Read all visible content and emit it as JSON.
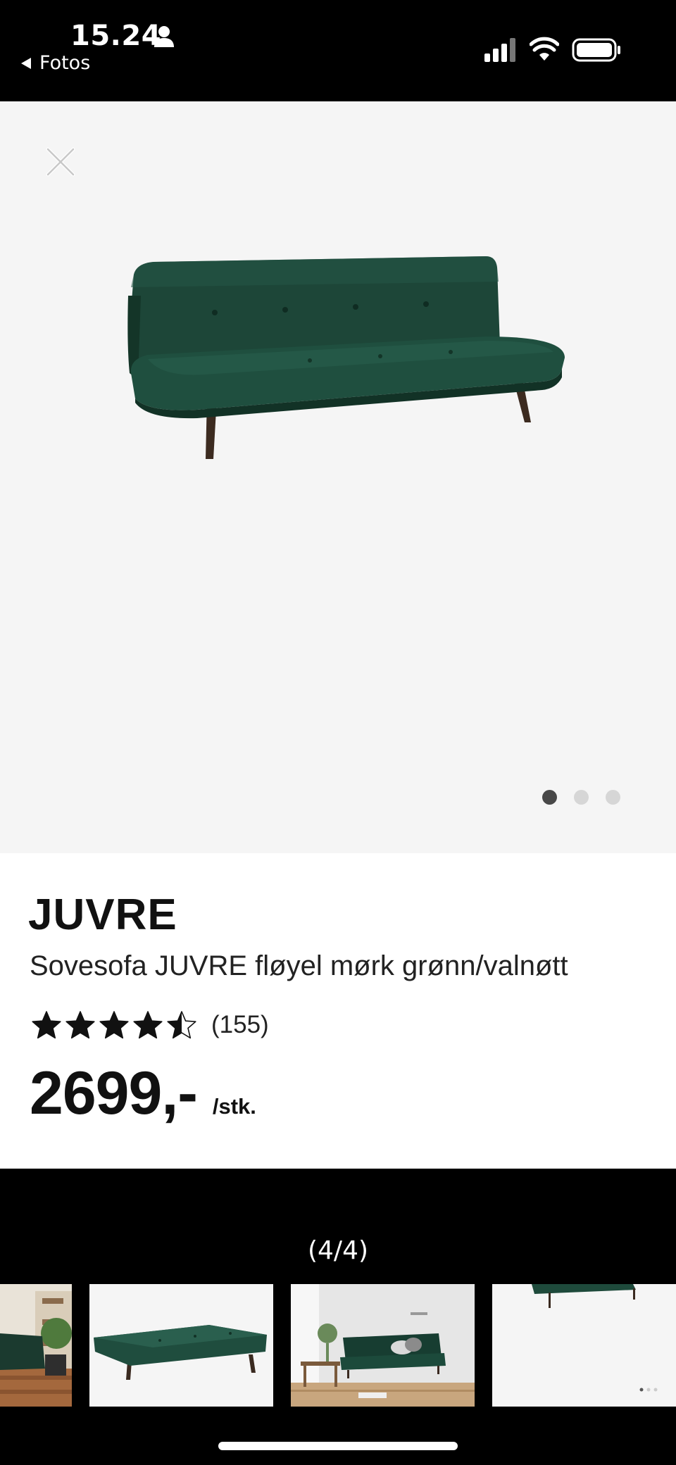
{
  "status_bar": {
    "time": "15.24",
    "back_label": "Fotos"
  },
  "product": {
    "brand": "JUVRE",
    "description": "Sovesofa JUVRE fløyel mørk grønn/valnøtt",
    "rating": 4.5,
    "review_count": "(155)",
    "price": "2699,-",
    "price_unit": "/stk."
  },
  "carousel": {
    "total_images": 3,
    "active_index": 0
  },
  "viewer": {
    "counter": "(4/4)"
  },
  "icons": {
    "close": "close-icon",
    "person": "person-icon",
    "signal": "cellular-signal-icon",
    "wifi": "wifi-icon",
    "battery": "battery-icon",
    "back": "back-arrow-icon",
    "star": "star-icon"
  },
  "colors": {
    "sofa_green": "#1f4a3b",
    "image_background": "#f5f5f5",
    "active_dot": "#484848",
    "inactive_dot": "#d6d6d6"
  }
}
